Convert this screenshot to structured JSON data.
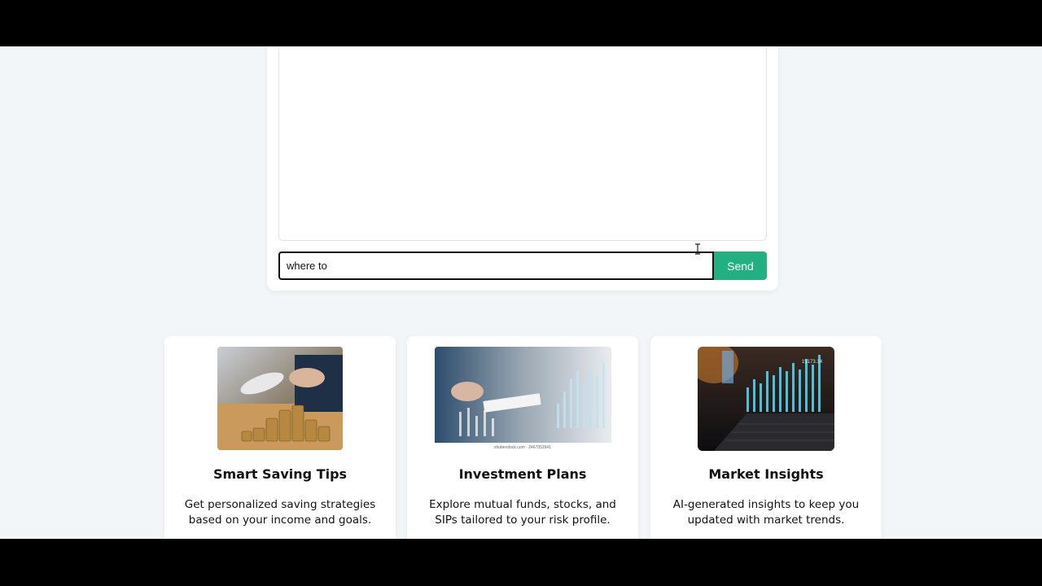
{
  "chat": {
    "input_value": "where to ",
    "send_label": "Send"
  },
  "cards": [
    {
      "title": "Smart Saving Tips",
      "description": "Get personalized saving strategies based on your income and goals.",
      "image_icon": "coins-calculator-photo"
    },
    {
      "title": "Investment Plans",
      "description": "Explore mutual funds, stocks, and SIPs tailored to your risk profile.",
      "image_icon": "investment-chart-photo",
      "image_caption": "shutterstock.com · 2467052941"
    },
    {
      "title": "Market Insights",
      "description": "AI-generated insights to keep you updated with market trends.",
      "image_icon": "laptop-market-chart-photo"
    }
  ],
  "colors": {
    "send_button": "#21b181",
    "page_background": "#f3f6f9"
  }
}
